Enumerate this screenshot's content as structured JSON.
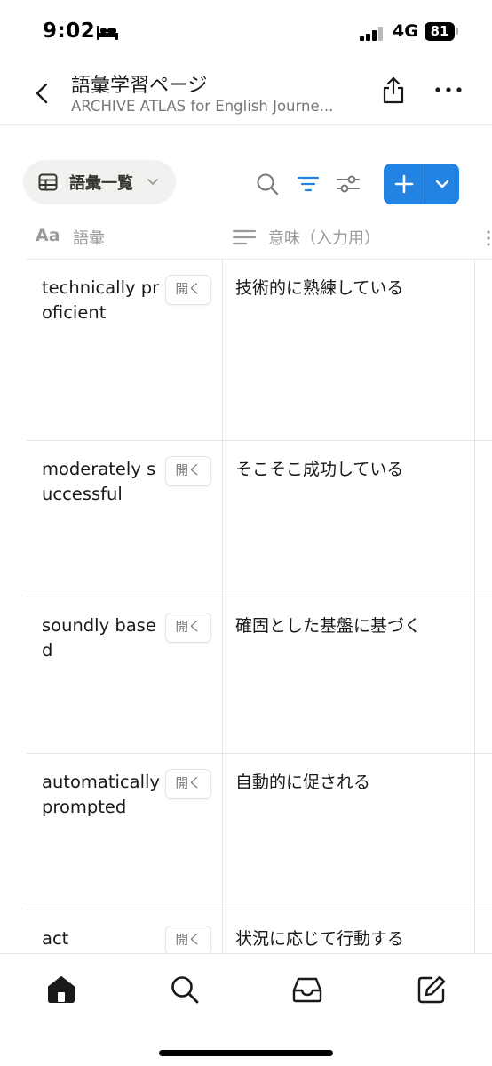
{
  "status_bar": {
    "time": "9:02",
    "network": "4G",
    "battery": "81"
  },
  "header": {
    "title": "語彙学習ページ",
    "subtitle": "ARCHIVE ATLAS for English Journe..."
  },
  "toolbar": {
    "view_label": "語彙一覧",
    "accent_color": "#2383e2"
  },
  "table": {
    "columns": [
      {
        "icon": "Aa",
        "label": "語彙"
      },
      {
        "icon": "text-lines-icon",
        "label": "意味（入力用）"
      }
    ],
    "open_label": "開く",
    "rows": [
      {
        "vocab": "technically proficient",
        "meaning": "技術的に熟練している"
      },
      {
        "vocab": "moderately successful",
        "meaning": "そこそこ成功している"
      },
      {
        "vocab": "soundly based",
        "meaning": "確固とした基盤に基づく"
      },
      {
        "vocab": "automatically prompted",
        "meaning": "自動的に促される"
      },
      {
        "vocab": "act",
        "meaning": "状況に応じて行動する"
      }
    ]
  },
  "bottom_nav": [
    {
      "icon": "home-icon"
    },
    {
      "icon": "search-icon"
    },
    {
      "icon": "inbox-icon"
    },
    {
      "icon": "compose-icon"
    }
  ]
}
